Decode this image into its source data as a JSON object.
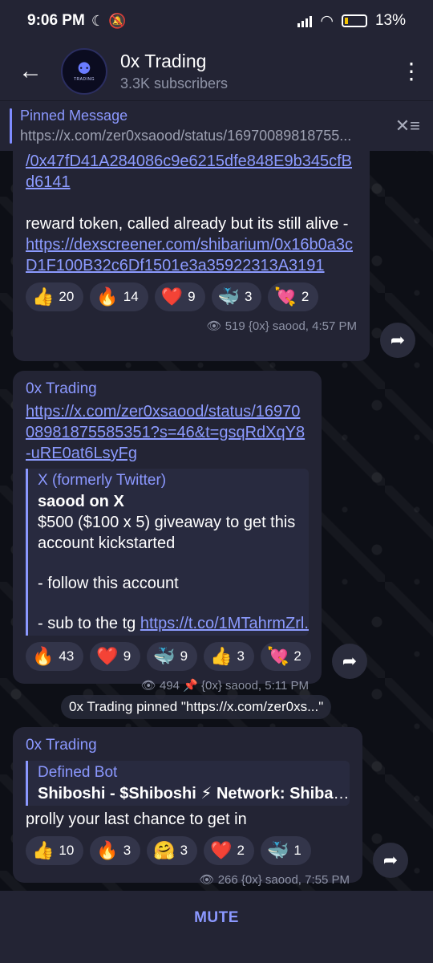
{
  "status_bar": {
    "time": "9:06 PM",
    "left_icons": "☾ 🔕",
    "battery": "13%"
  },
  "header": {
    "back_icon": "←",
    "channel_name": "0x Trading",
    "subscribers": "3.3K subscribers",
    "avatar_glyph": "⚉",
    "avatar_text": "TRADING",
    "menu_icon": "⋮"
  },
  "pinned": {
    "title": "Pinned Message",
    "text": "https://x.com/zer0xsaood/status/16970089818755...",
    "icon": "✕≡"
  },
  "messages": [
    {
      "top_link": "/0x47fD41A284086c9e6215dfe848E9b345cfBd6141",
      "text": "reward token, called already but its still alive - ",
      "link": "https://dexscreener.com/shibarium/0x16b0a3cD1F100B32c6Df1501e3a35922313A3191",
      "reactions": [
        {
          "emoji": "👍",
          "count": "20"
        },
        {
          "emoji": "🔥",
          "count": "14"
        },
        {
          "emoji": "❤️",
          "count": "9"
        },
        {
          "emoji": "🐳",
          "count": "3"
        },
        {
          "emoji": "💘",
          "count": "2"
        }
      ],
      "views": "519",
      "signature": "{0x} saood, 4:57 PM"
    },
    {
      "author": "0x Trading",
      "link": "https://x.com/zer0xsaood/status/1697008981875585351?s=46&t=gsqRdXqY8-uRE0at6LsyFg",
      "quote": {
        "site": "X (formerly Twitter)",
        "title": "saood on X",
        "line1": "$500 ($100 x 5) giveaway to get this account kickstarted",
        "line2": "- follow this account",
        "line3_prefix": "- sub to the tg ",
        "line3_link": "https://t.co/1MTahrmZrl..."
      },
      "reactions": [
        {
          "emoji": "🔥",
          "count": "43"
        },
        {
          "emoji": "❤️",
          "count": "9"
        },
        {
          "emoji": "🐳",
          "count": "9"
        },
        {
          "emoji": "👍",
          "count": "3"
        },
        {
          "emoji": "💘",
          "count": "2"
        }
      ],
      "views": "494",
      "signature": "{0x} saood, 5:11 PM"
    },
    {
      "author": "0x Trading",
      "quote": {
        "site": "Defined Bot",
        "title": "Shiboshi - $Shiboshi ⚡ Network: Shibarium..."
      },
      "text": "prolly your last chance to get in",
      "reactions": [
        {
          "emoji": "👍",
          "count": "10"
        },
        {
          "emoji": "🔥",
          "count": "3"
        },
        {
          "emoji": "🤗",
          "count": "3"
        },
        {
          "emoji": "❤️",
          "count": "2"
        },
        {
          "emoji": "🐳",
          "count": "1"
        }
      ],
      "views": "266",
      "signature": "{0x} saood, 7:55 PM"
    }
  ],
  "service_message": "0x Trading pinned \"https://x.com/zer0xs...\"",
  "bottom": {
    "mute_label": "MUTE"
  },
  "icons": {
    "eye": "👁",
    "pin": "📌",
    "forward": "➦"
  }
}
